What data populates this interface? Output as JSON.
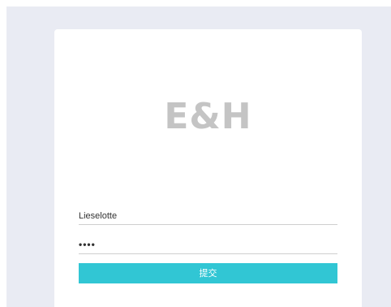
{
  "brand": {
    "logo_text": "E&H"
  },
  "login_form": {
    "username_value": "Lieselotte",
    "password_value": "••••",
    "submit_label": "提交"
  },
  "colors": {
    "page_background": "#e9ebf3",
    "card_background": "#ffffff",
    "logo_text": "#c4c4c4",
    "submit_button": "#31c6d4",
    "field_underline": "#cfcfcf"
  }
}
